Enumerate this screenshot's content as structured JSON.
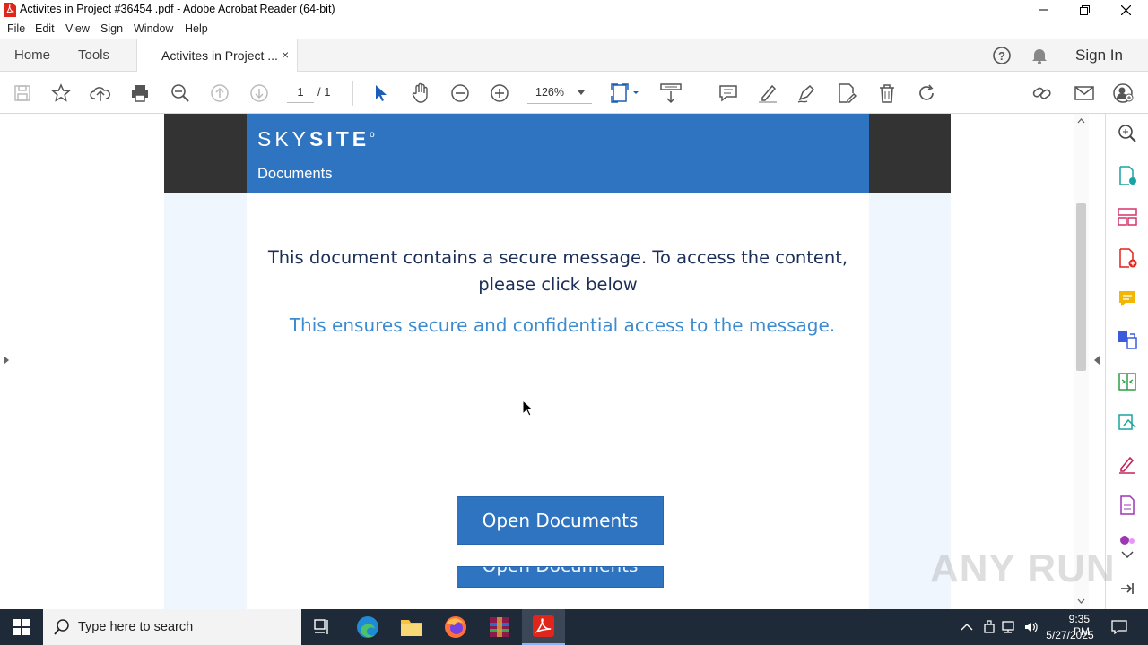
{
  "window": {
    "title": "Activites in Project #36454 .pdf - Adobe Acrobat Reader (64-bit)"
  },
  "menu": [
    "File",
    "Edit",
    "View",
    "Sign",
    "Window",
    "Help"
  ],
  "tabs": {
    "home": "Home",
    "tools": "Tools",
    "document": "Activites in Project ...",
    "close": "×",
    "sign_in": "Sign In"
  },
  "toolbar": {
    "page_current": "1",
    "page_total": "/ 1",
    "zoom": "126%"
  },
  "document": {
    "brand_light": "SKY",
    "brand_bold": "SITE",
    "brand_mark": "o",
    "header_subtitle": "Documents",
    "message_primary": "This document contains a secure message. To access the content, please click below",
    "message_secondary": "This ensures secure and confidential access to the message.",
    "button_label": "Open Documents",
    "button_label_duplicate": "Open Documents"
  },
  "watermark": "ANY RUN",
  "taskbar": {
    "search_placeholder": "Type here to search",
    "time": "9:35 PM",
    "date": "5/27/2025"
  },
  "colors": {
    "brand_blue": "#2f74c0",
    "dark_band": "#333333",
    "message_dark": "#1c2f57",
    "message_light": "#3d8bd0",
    "acrobat_red": "#e0251b",
    "taskbar": "#1f2a38"
  }
}
